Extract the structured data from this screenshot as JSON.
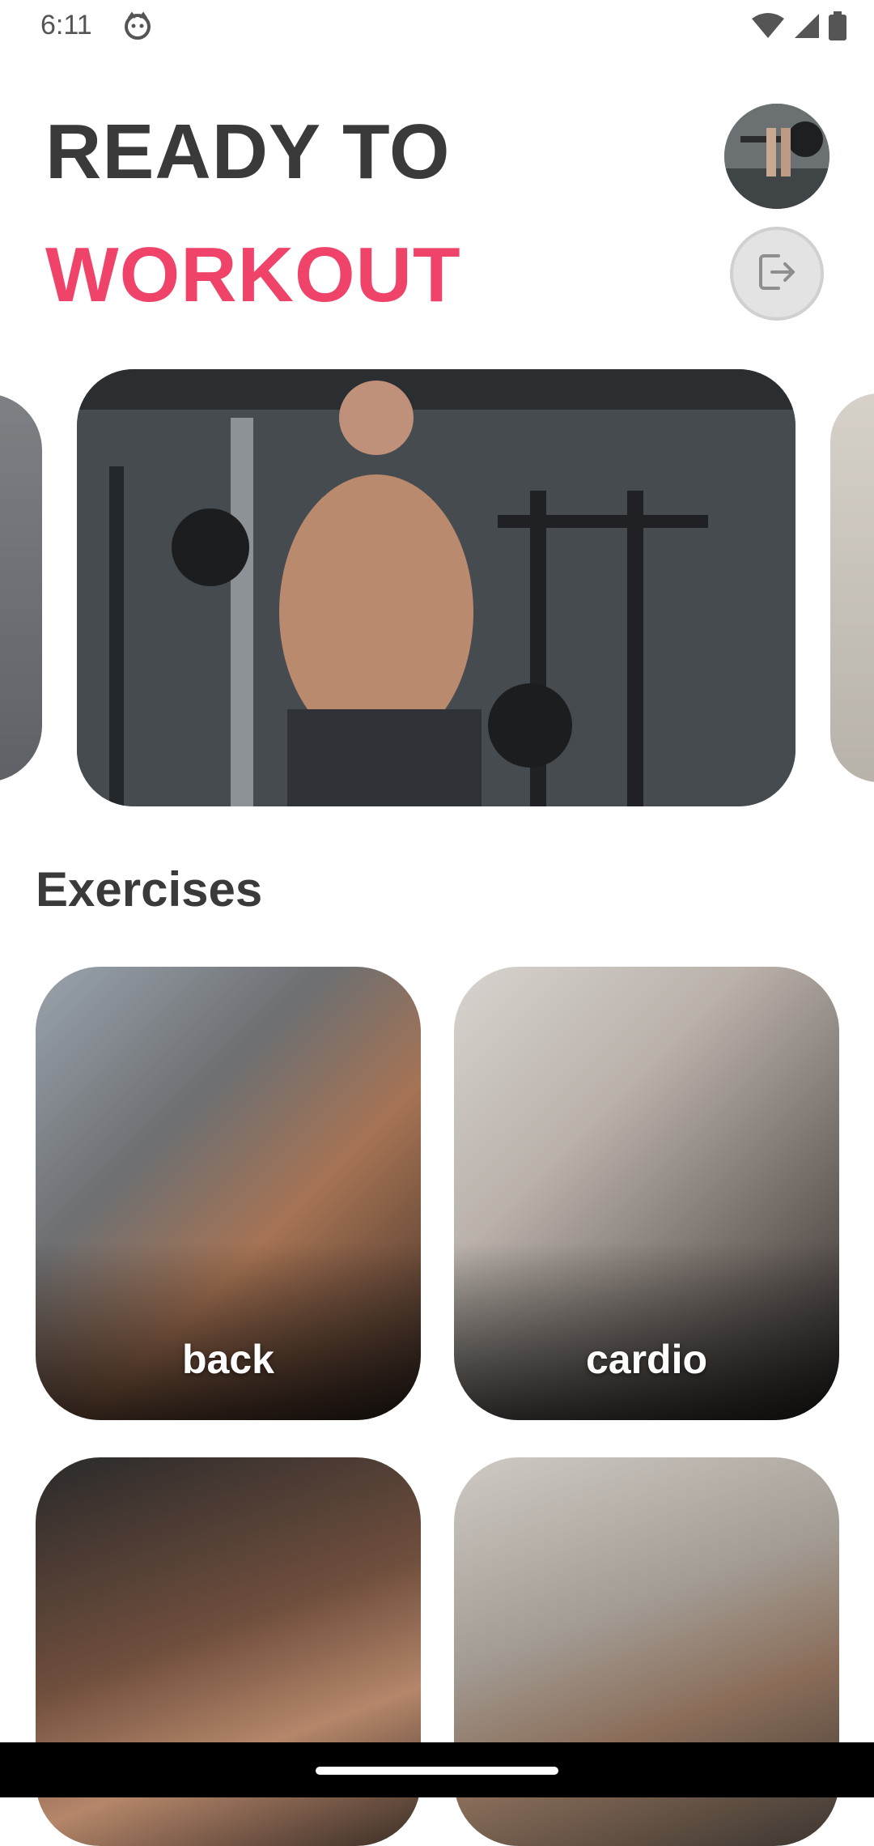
{
  "status_bar": {
    "time": "6:11",
    "icons": [
      "app-notification-icon",
      "wifi-icon",
      "cellular-signal-icon",
      "battery-icon"
    ]
  },
  "header": {
    "title_line1": "READY TO",
    "title_line2": "WORKOUT",
    "accent_color": "#f0436a",
    "avatar_icon": "avatar",
    "logout_icon": "logout-icon"
  },
  "carousel": {
    "slides": [
      "workout-image-left",
      "workout-image-main",
      "workout-image-right"
    ]
  },
  "exercises": {
    "section_title": "Exercises",
    "categories": [
      {
        "label": "back"
      },
      {
        "label": "cardio"
      },
      {
        "label": ""
      },
      {
        "label": ""
      }
    ]
  }
}
